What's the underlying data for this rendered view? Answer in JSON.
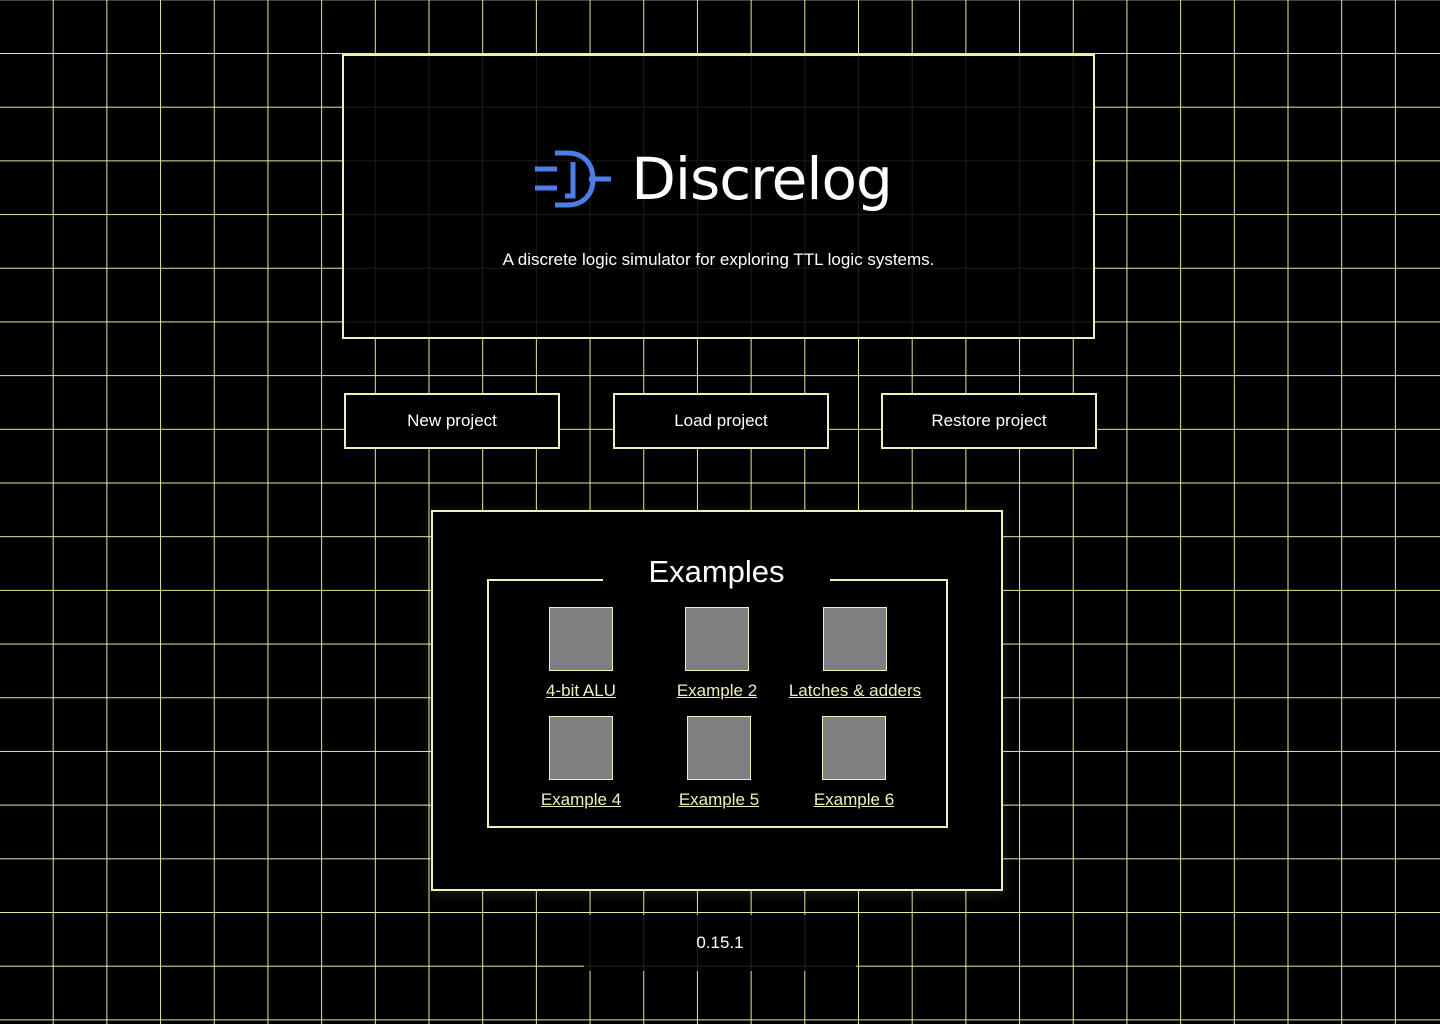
{
  "app": {
    "title": "Discrelog",
    "tagline": "A discrete logic simulator for exploring TTL logic systems.",
    "logo_icon": "logic-gate-icon"
  },
  "actions": {
    "new_project": "New project",
    "load_project": "Load project",
    "restore_project": "Restore project"
  },
  "examples": {
    "title": "Examples",
    "items": [
      {
        "label": "4-bit ALU"
      },
      {
        "label": "Example 2"
      },
      {
        "label": "Latches & adders"
      },
      {
        "label": "Example 4"
      },
      {
        "label": "Example 5"
      },
      {
        "label": "Example 6"
      }
    ]
  },
  "footer": {
    "version": "0.15.1"
  },
  "colors": {
    "background": "#000000",
    "grid_line": "#e6e6a4",
    "border": "#f0f0b8",
    "link": "#f0f0b8",
    "logo": "#4d7de8",
    "thumbnail": "#7f7f7f",
    "text": "#ffffff"
  }
}
